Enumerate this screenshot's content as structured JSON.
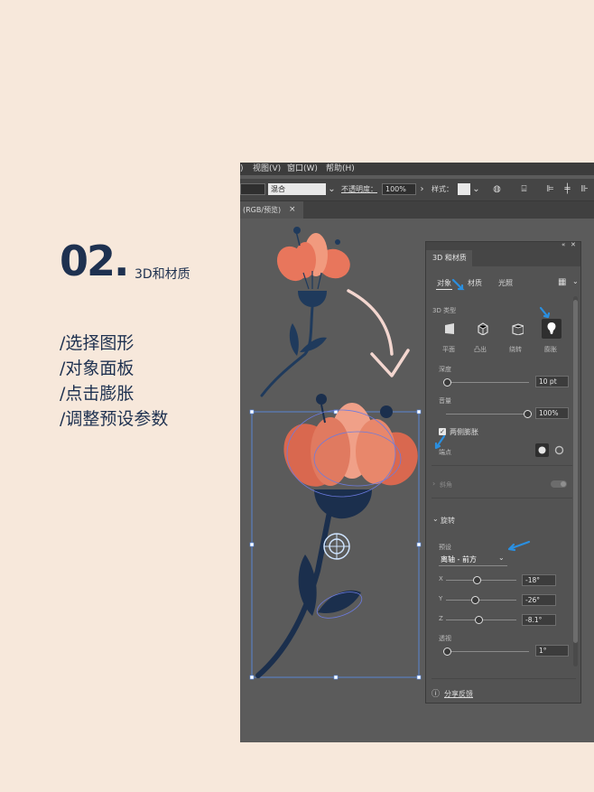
{
  "heading": {
    "number": "02.",
    "title": "3D和材质"
  },
  "steps": [
    "/选择图形",
    "/对象面板",
    "/点击膨胀",
    "/调整预设参数"
  ],
  "menubar": {
    "items": [
      ")",
      "视图(V)",
      "窗口(W)",
      "帮助(H)"
    ]
  },
  "toolbar": {
    "blend_mode": "混合",
    "opacity_label": "不透明度：",
    "opacity_value": "100%",
    "style_label": "样式："
  },
  "doc_tab": {
    "label": "(RGB/预览)",
    "close": "×"
  },
  "panel": {
    "title": "3D 和材质",
    "tabs": [
      "对象",
      "材质",
      "光照"
    ],
    "section_3d_type": "3D 类型",
    "types": [
      "平面",
      "凸出",
      "绕转",
      "膨胀"
    ],
    "depth_label": "深度",
    "depth_value": "10 pt",
    "volume_label": "音量",
    "volume_value": "100%",
    "both_sides_label": "两侧膨胀",
    "cap_label": "端点",
    "bevel_label": "斜角",
    "rotation_label": "旋转",
    "preset_label": "预设",
    "preset_value": "离轴 - 前方",
    "x_label": "X",
    "x_value": "-18°",
    "y_label": "Y",
    "y_value": "-26°",
    "z_label": "Z",
    "z_value": "-8.1°",
    "perspective_label": "透视",
    "perspective_value": "1°",
    "feedback_label": "分享反馈"
  },
  "colors": {
    "background": "#f7e8db",
    "heading": "#1e3150",
    "petal": "#e8765c",
    "stem": "#1f3a5c",
    "highlight_arrow": "#2a8fe0"
  }
}
